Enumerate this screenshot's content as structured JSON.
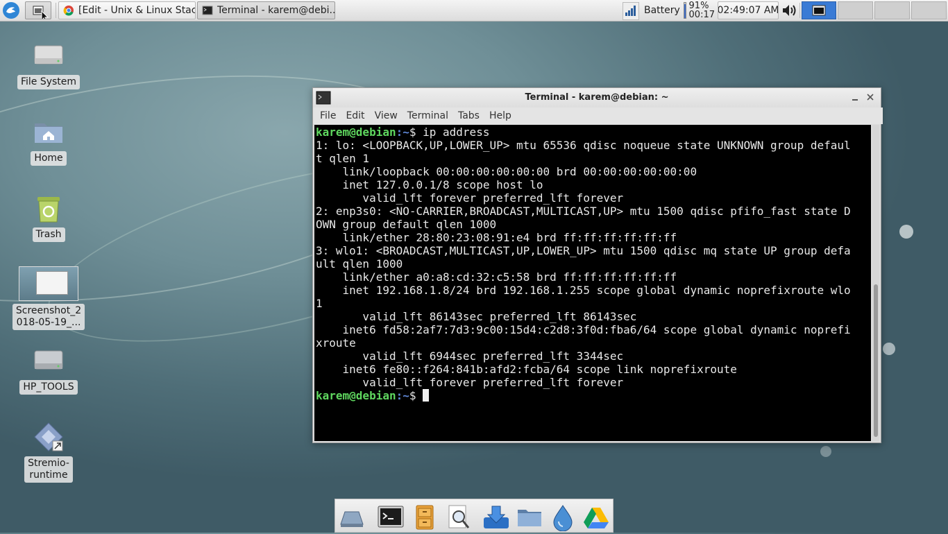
{
  "panel": {
    "tasks": [
      {
        "label": "[Edit - Unix & Linux Stac...",
        "icon": "chrome-icon"
      },
      {
        "label": "Terminal - karem@debi...",
        "icon": "terminal-icon"
      }
    ],
    "battery_label": "Battery",
    "battery_percent": "91%",
    "battery_time": "00:17",
    "battery_level": 0.91,
    "clock": "02:49:07 AM"
  },
  "desktop": {
    "icons": [
      {
        "label": "File System",
        "icon": "drive-icon"
      },
      {
        "label": "Home",
        "icon": "home-folder-icon"
      },
      {
        "label": "Trash",
        "icon": "trash-icon"
      },
      {
        "label": "Screenshot_2\n018-05-19_...",
        "icon": "screenshot-thumbnail-icon"
      },
      {
        "label": "HP_TOOLS",
        "icon": "drive-icon"
      },
      {
        "label": "Stremio-\nruntime",
        "icon": "stremio-icon"
      }
    ]
  },
  "terminal": {
    "title": "Terminal - karem@debian: ~",
    "menus": [
      "File",
      "Edit",
      "View",
      "Terminal",
      "Tabs",
      "Help"
    ],
    "prompt_user": "karem@debian",
    "prompt_path": ":~",
    "prompt_symbol": "$ ",
    "command": "ip address",
    "output": [
      "1: lo: <LOOPBACK,UP,LOWER_UP> mtu 65536 qdisc noqueue state UNKNOWN group defaul",
      "t qlen 1",
      "    link/loopback 00:00:00:00:00:00 brd 00:00:00:00:00:00",
      "    inet 127.0.0.1/8 scope host lo",
      "       valid_lft forever preferred_lft forever",
      "2: enp3s0: <NO-CARRIER,BROADCAST,MULTICAST,UP> mtu 1500 qdisc pfifo_fast state D",
      "OWN group default qlen 1000",
      "    link/ether 28:80:23:08:91:e4 brd ff:ff:ff:ff:ff:ff",
      "3: wlo1: <BROADCAST,MULTICAST,UP,LOWER_UP> mtu 1500 qdisc mq state UP group defa",
      "ult qlen 1000",
      "    link/ether a0:a8:cd:32:c5:58 brd ff:ff:ff:ff:ff:ff",
      "    inet 192.168.1.8/24 brd 192.168.1.255 scope global dynamic noprefixroute wlo",
      "1",
      "       valid_lft 86143sec preferred_lft 86143sec",
      "    inet6 fd58:2af7:7d3:9c00:15d4:c2d8:3f0d:fba6/64 scope global dynamic noprefi",
      "xroute",
      "       valid_lft 6944sec preferred_lft 3344sec",
      "    inet6 fe80::f264:841b:afd2:fcba/64 scope link noprefixroute",
      "       valid_lft forever preferred_lft forever"
    ]
  },
  "dock": {
    "items": [
      "show-desktop-icon",
      "terminal-icon",
      "file-cabinet-icon",
      "search-icon",
      "downloader-icon",
      "folder-icon",
      "droplet-icon",
      "google-drive-icon"
    ]
  },
  "colors": {
    "prompt_user": "#5fd75f",
    "prompt_path": "#5f87d7",
    "panel_selected": "#3a7bd5"
  }
}
